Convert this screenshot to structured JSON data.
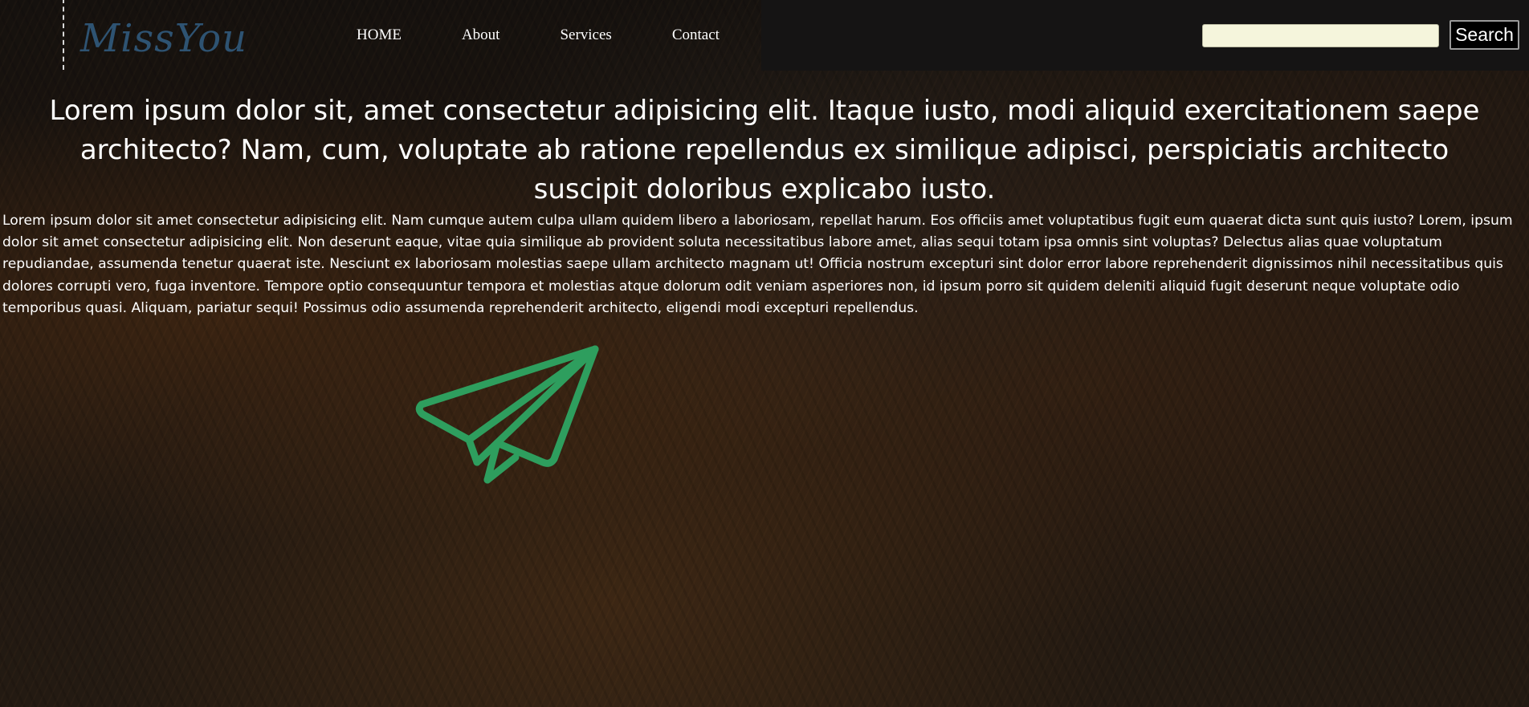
{
  "logo": {
    "text": "MissYou",
    "color": "#2e5372"
  },
  "nav": {
    "items": [
      {
        "label": "HOME"
      },
      {
        "label": "About"
      },
      {
        "label": "Services"
      },
      {
        "label": "Contact"
      }
    ]
  },
  "search": {
    "value": "",
    "placeholder": "",
    "button_label": "Search"
  },
  "main": {
    "headline": "Lorem ipsum dolor sit, amet consectetur adipisicing elit. Itaque iusto, modi aliquid exercitationem saepe architecto? Nam, cum, voluptate ab ratione repellendus ex similique adipisci, perspiciatis architecto suscipit doloribus explicabo iusto.",
    "paragraph": "Lorem ipsum dolor sit amet consectetur adipisicing elit. Nam cumque autem culpa ullam quidem libero a laboriosam, repellat harum. Eos officiis amet voluptatibus fugit eum quaerat dicta sunt quis iusto? Lorem, ipsum dolor sit amet consectetur adipisicing elit. Non deserunt eaque, vitae quia similique ab provident soluta necessitatibus labore amet, alias sequi totam ipsa omnis sint voluptas? Delectus alias quae voluptatum repudiandae, assumenda tenetur quaerat iste. Nesciunt ex laboriosam molestias saepe ullam architecto magnam ut! Officia nostrum excepturi sint dolor error labore reprehenderit dignissimos nihil necessitatibus quis dolores corrupti vero, fuga inventore. Tempore optio consequuntur tempora et molestias atque dolorum odit veniam asperiores non, id ipsum porro sit quidem deleniti aliquid fugit deserunt neque voluptate odio temporibus quasi. Aliquam, pariatur sequi! Possimus odio assumenda reprehenderit architecto, eligendi modi excepturi repellendus."
  },
  "icons": {
    "plane": {
      "name": "paper-plane-icon",
      "color": "#2e9e5e"
    }
  }
}
